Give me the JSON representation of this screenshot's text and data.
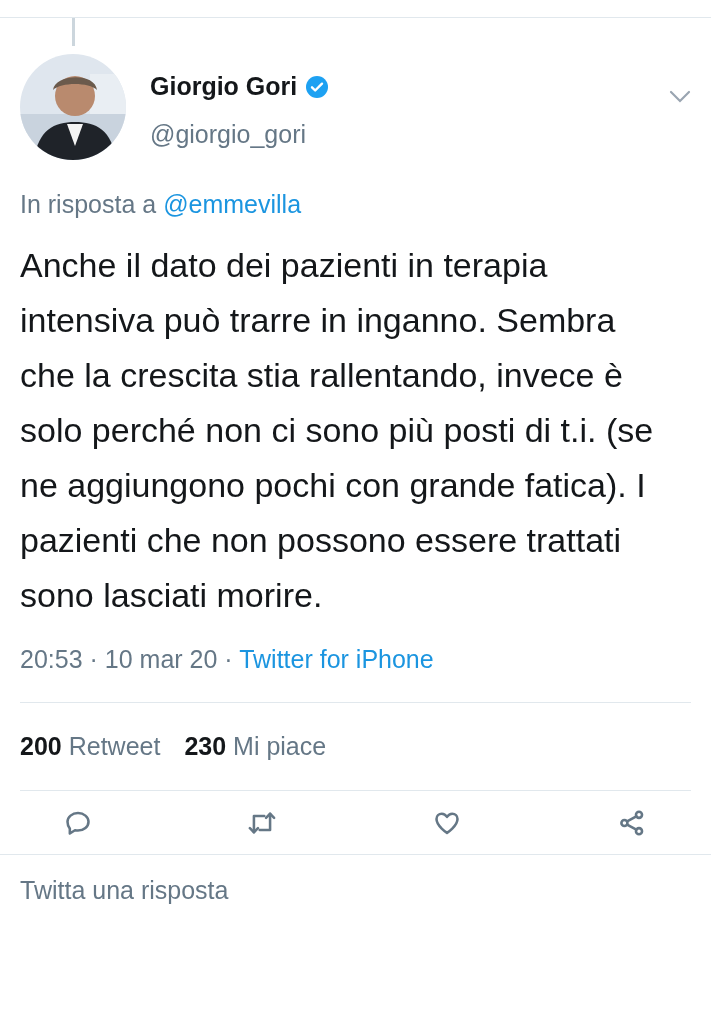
{
  "author": {
    "name": "Giorgio Gori",
    "verified": true,
    "handle": "@giorgio_gori"
  },
  "reply_to": {
    "prefix": "In risposta a",
    "mention": "@emmevilla"
  },
  "text": "Anche il dato dei pazienti in terapia intensiva può trarre in inganno. Sembra che la crescita stia rallentando, invece è solo perché non ci sono più posti di t.i. (se ne aggiungono pochi con grande fatica). I pazienti che non possono essere trattati sono lasciati morire.",
  "meta": {
    "time": "20:53",
    "sep_1": "·",
    "date": "10 mar 20",
    "sep_2": "·",
    "source": "Twitter for iPhone"
  },
  "stats": [
    {
      "count": "200",
      "label": "Retweet"
    },
    {
      "count": "230",
      "label": "Mi piace"
    }
  ],
  "actions": [
    {
      "kind": "reply"
    },
    {
      "kind": "retweet"
    },
    {
      "kind": "like"
    },
    {
      "kind": "share"
    }
  ],
  "reply_box": {
    "placeholder": "Twitta una risposta"
  }
}
